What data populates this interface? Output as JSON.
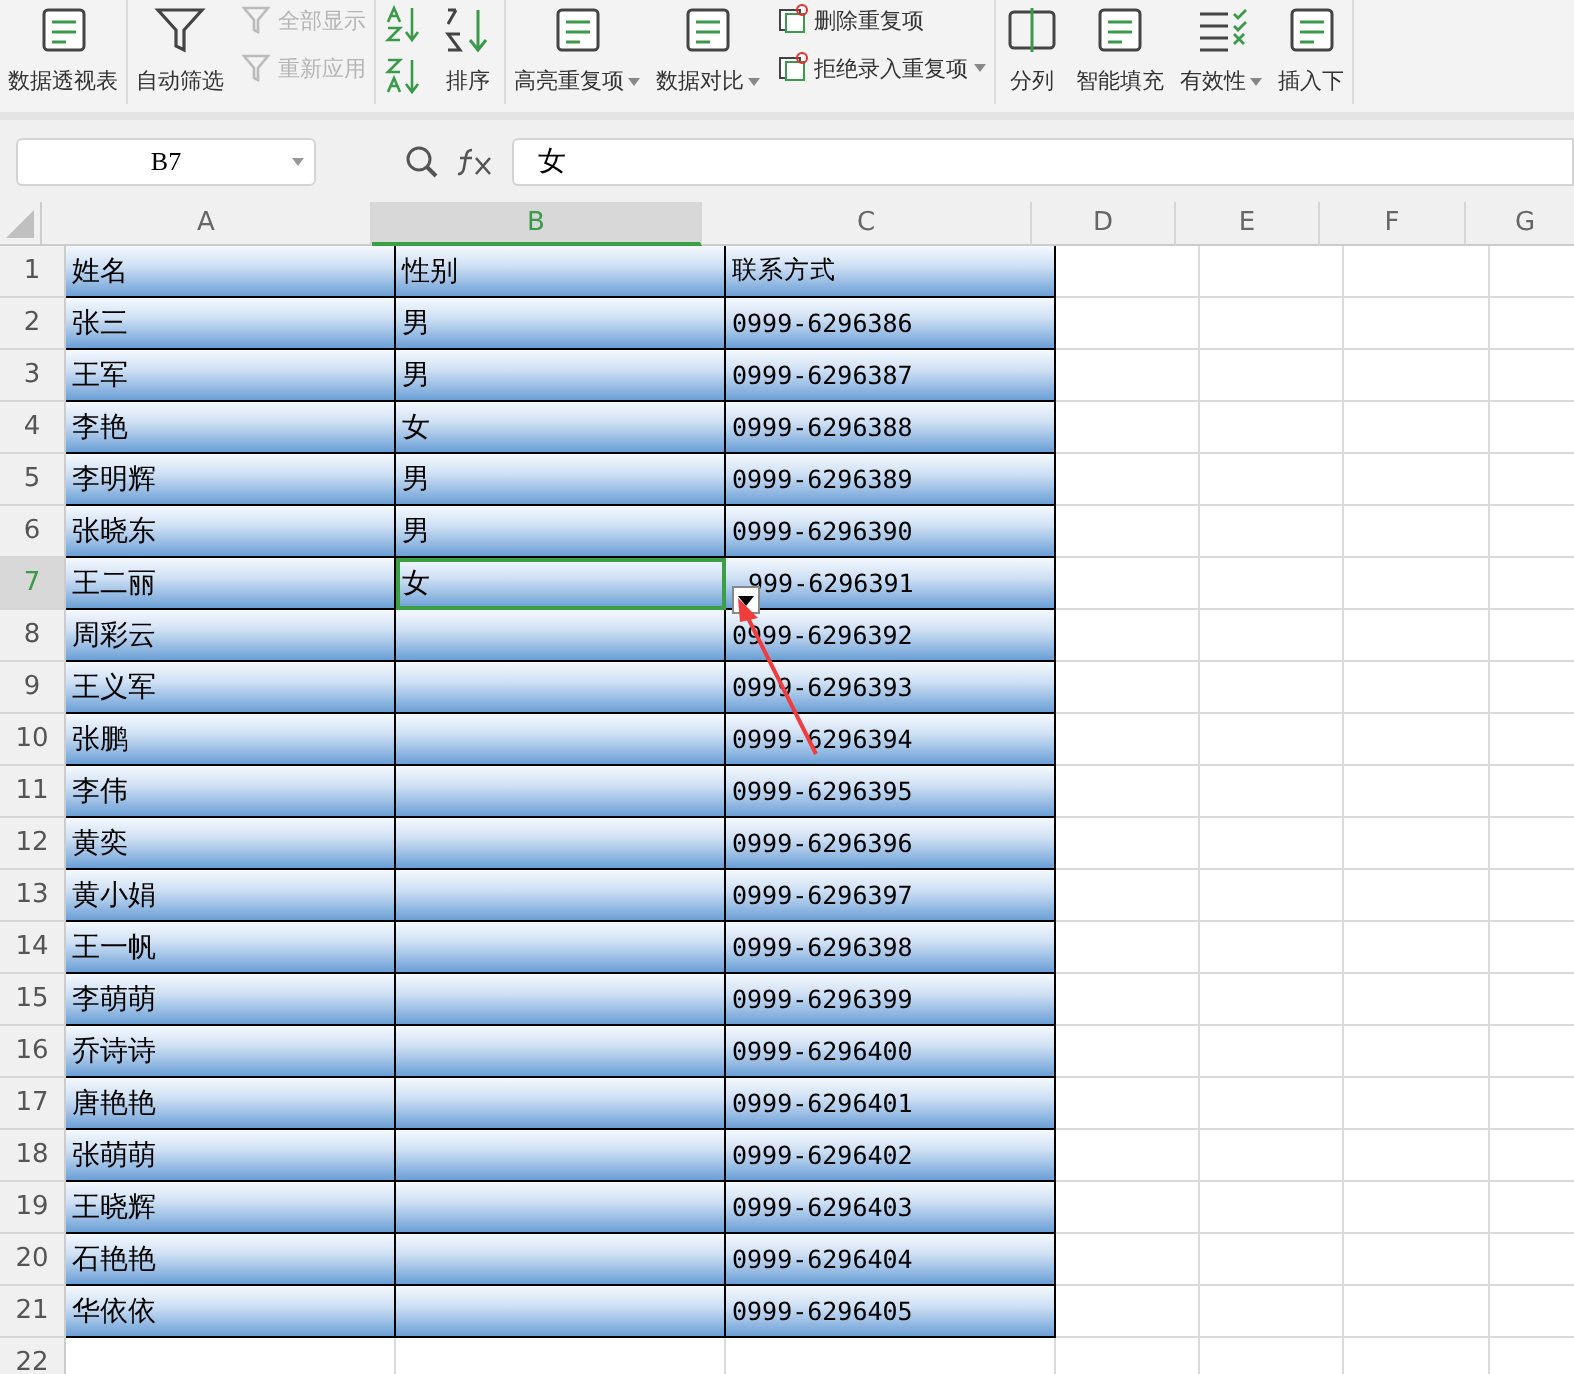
{
  "ribbon": [
    {
      "items": [
        {
          "kind": "large",
          "label": "数据透视表",
          "dropdown": false
        }
      ]
    },
    {
      "items": [
        {
          "kind": "large",
          "label": "自动筛选",
          "dropdown": false
        },
        {
          "kind": "stack",
          "rows": [
            {
              "label": "全部显示",
              "disabled": true,
              "dropdown": false
            },
            {
              "label": "重新应用",
              "disabled": true,
              "dropdown": false
            }
          ]
        }
      ]
    },
    {
      "items": [
        {
          "kind": "sorticons"
        },
        {
          "kind": "large",
          "label": "排序",
          "dropdown": false
        }
      ]
    },
    {
      "items": [
        {
          "kind": "large",
          "label": "高亮重复项",
          "dropdown": true
        },
        {
          "kind": "large",
          "label": "数据对比",
          "dropdown": true
        },
        {
          "kind": "stack",
          "rows": [
            {
              "label": "删除重复项",
              "disabled": false,
              "dropdown": false
            },
            {
              "label": "拒绝录入重复项",
              "disabled": false,
              "dropdown": true
            }
          ]
        }
      ]
    },
    {
      "items": [
        {
          "kind": "large",
          "label": "分列",
          "dropdown": false
        },
        {
          "kind": "large",
          "label": "智能填充",
          "dropdown": false
        },
        {
          "kind": "large",
          "label": "有效性",
          "dropdown": true
        },
        {
          "kind": "large",
          "label": "插入下",
          "dropdown": false
        }
      ]
    }
  ],
  "name_box": "B7",
  "formula": "女",
  "columns": [
    {
      "label": "A",
      "selected": false
    },
    {
      "label": "B",
      "selected": true
    },
    {
      "label": "C",
      "selected": false
    },
    {
      "label": "D",
      "selected": false
    },
    {
      "label": "E",
      "selected": false
    },
    {
      "label": "F",
      "selected": false
    },
    {
      "label": "G",
      "selected": false
    }
  ],
  "rows": [
    {
      "num": "1",
      "selected": false,
      "cells": [
        "姓名",
        "性别",
        "联系方式"
      ]
    },
    {
      "num": "2",
      "selected": false,
      "cells": [
        "张三",
        "男",
        "0999-6296386"
      ]
    },
    {
      "num": "3",
      "selected": false,
      "cells": [
        "王军",
        "男",
        "0999-6296387"
      ]
    },
    {
      "num": "4",
      "selected": false,
      "cells": [
        "李艳",
        "女",
        "0999-6296388"
      ]
    },
    {
      "num": "5",
      "selected": false,
      "cells": [
        "李明辉",
        "男",
        "0999-6296389"
      ]
    },
    {
      "num": "6",
      "selected": false,
      "cells": [
        "张晓东",
        "男",
        "0999-6296390"
      ]
    },
    {
      "num": "7",
      "selected": true,
      "cells": [
        "王二丽",
        "女",
        "999-6296391"
      ]
    },
    {
      "num": "8",
      "selected": false,
      "cells": [
        "周彩云",
        "",
        "0999-6296392"
      ]
    },
    {
      "num": "9",
      "selected": false,
      "cells": [
        "王义军",
        "",
        "0999-6296393"
      ]
    },
    {
      "num": "10",
      "selected": false,
      "cells": [
        "张鹏",
        "",
        "0999-6296394"
      ]
    },
    {
      "num": "11",
      "selected": false,
      "cells": [
        "李伟",
        "",
        "0999-6296395"
      ]
    },
    {
      "num": "12",
      "selected": false,
      "cells": [
        "黄奕",
        "",
        "0999-6296396"
      ]
    },
    {
      "num": "13",
      "selected": false,
      "cells": [
        "黄小娟",
        "",
        "0999-6296397"
      ]
    },
    {
      "num": "14",
      "selected": false,
      "cells": [
        "王一帆",
        "",
        "0999-6296398"
      ]
    },
    {
      "num": "15",
      "selected": false,
      "cells": [
        "李萌萌",
        "",
        "0999-6296399"
      ]
    },
    {
      "num": "16",
      "selected": false,
      "cells": [
        "乔诗诗",
        "",
        "0999-6296400"
      ]
    },
    {
      "num": "17",
      "selected": false,
      "cells": [
        "唐艳艳",
        "",
        "0999-6296401"
      ]
    },
    {
      "num": "18",
      "selected": false,
      "cells": [
        "张萌萌",
        "",
        "0999-6296402"
      ]
    },
    {
      "num": "19",
      "selected": false,
      "cells": [
        "王晓辉",
        "",
        "0999-6296403"
      ]
    },
    {
      "num": "20",
      "selected": false,
      "cells": [
        "石艳艳",
        "",
        "0999-6296404"
      ]
    },
    {
      "num": "21",
      "selected": false,
      "cells": [
        "华依依",
        "",
        "0999-6296405"
      ]
    },
    {
      "num": "22",
      "selected": false
    }
  ]
}
